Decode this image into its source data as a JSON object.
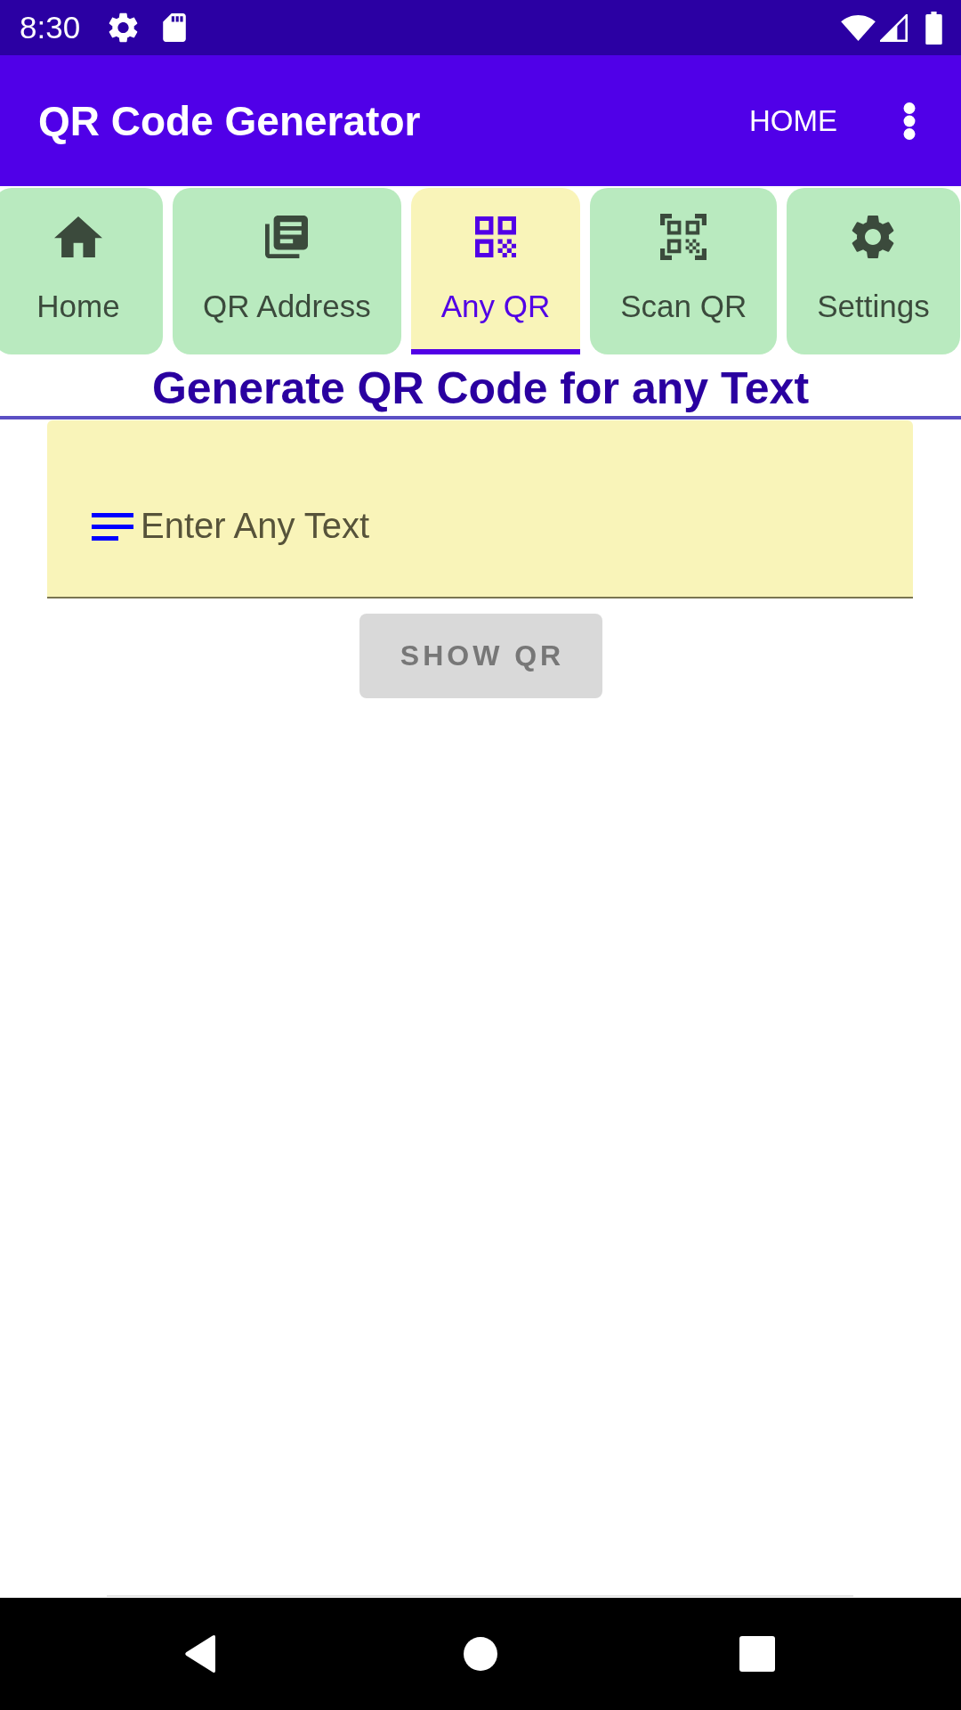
{
  "status_bar": {
    "time": "8:30"
  },
  "app_bar": {
    "title": "QR Code Generator",
    "action": "HOME"
  },
  "tabs": [
    {
      "label": "Home",
      "selected": false
    },
    {
      "label": "QR Address",
      "selected": false
    },
    {
      "label": "Any QR",
      "selected": true
    },
    {
      "label": "Scan QR",
      "selected": false
    },
    {
      "label": "Settings",
      "selected": false
    }
  ],
  "heading": "Generate QR Code for any Text",
  "text_field": {
    "placeholder": "Enter Any Text"
  },
  "show_button": {
    "label": "SHOW QR",
    "disabled": true
  }
}
